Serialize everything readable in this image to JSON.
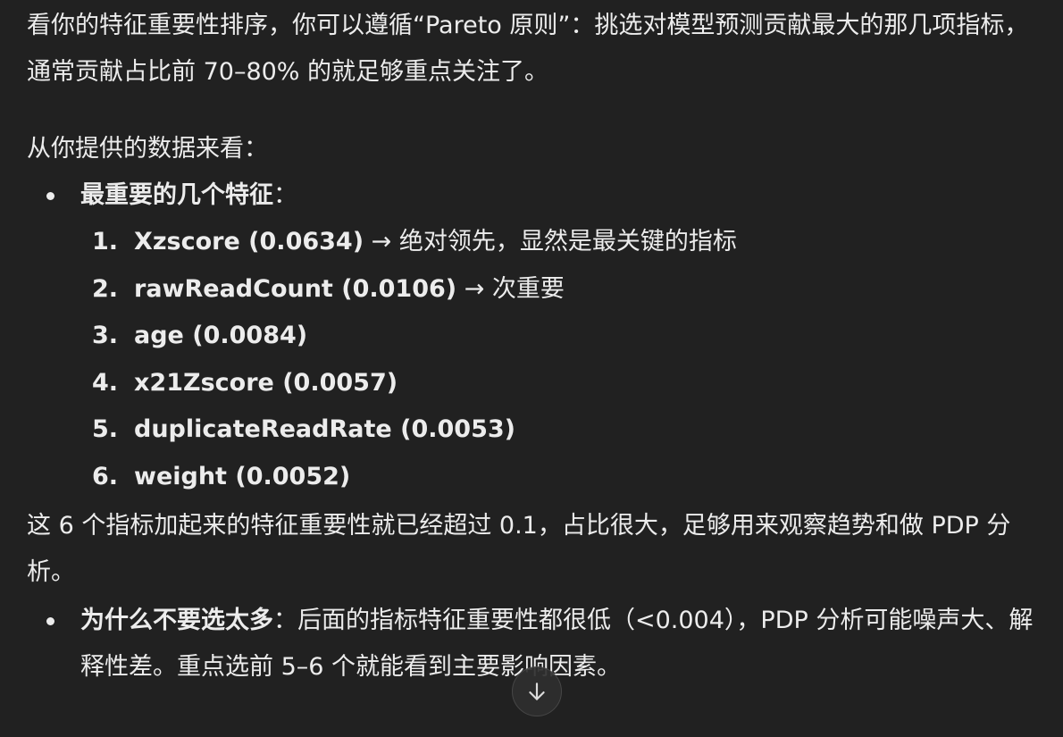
{
  "intro": {
    "line": "看你的特征重要性排序，你可以遵循“Pareto 原则”：挑选对模型预测贡献最大的那几项指标，通常贡献占比前 70–80% 的就足够重点关注了。"
  },
  "data_lead": "从你提供的数据来看：",
  "most_important": {
    "label": "最重要的几个特征",
    "colon": "：",
    "features": [
      {
        "num": "1.",
        "name": "Xzscore (0.0634)",
        "note": " → 绝对领先，显然是最关键的指标"
      },
      {
        "num": "2.",
        "name": "rawReadCount (0.0106)",
        "note": " → 次重要"
      },
      {
        "num": "3.",
        "name": "age (0.0084)",
        "note": ""
      },
      {
        "num": "4.",
        "name": "x21Zscore (0.0057)",
        "note": ""
      },
      {
        "num": "5.",
        "name": "duplicateReadRate (0.0053)",
        "note": ""
      },
      {
        "num": "6.",
        "name": "weight (0.0052)",
        "note": ""
      }
    ]
  },
  "summary": "这 6 个指标加起来的特征重要性就已经超过 0.1，占比很大，足够用来观察趋势和做 PDP 分析。",
  "why_not_more": {
    "label": "为什么不要选太多",
    "text": "：后面的指标特征重要性都很低（<0.004），PDP 分析可能噪声大、解释性差。重点选前 5–6 个就能看到主要影响因素。"
  },
  "scroll_button": {
    "icon": "arrow-down-icon"
  }
}
